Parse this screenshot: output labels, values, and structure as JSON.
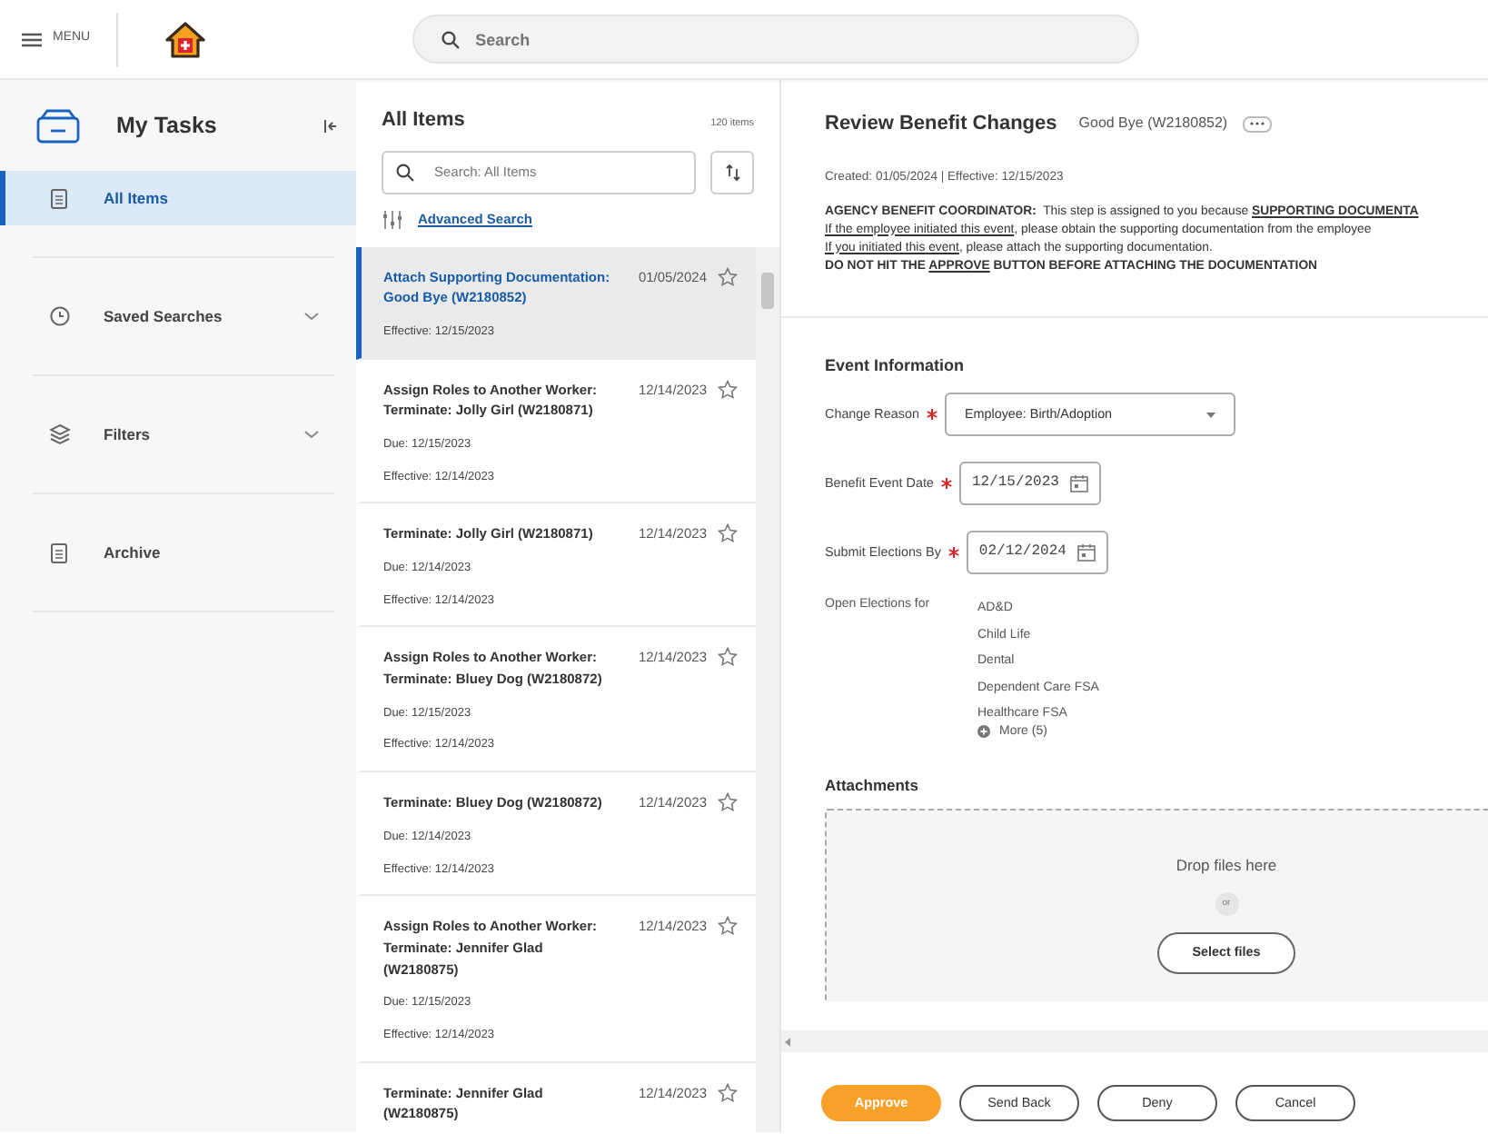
{
  "topbar": {
    "menu_label": "MENU",
    "search_placeholder": "Search"
  },
  "sidebar": {
    "title": "My Tasks",
    "items": [
      {
        "label": "All Items",
        "selected": true,
        "expandable": false
      },
      {
        "label": "Saved Searches",
        "selected": false,
        "expandable": true
      },
      {
        "label": "Filters",
        "selected": false,
        "expandable": true
      },
      {
        "label": "Archive",
        "selected": false,
        "expandable": false
      }
    ]
  },
  "list": {
    "title": "All Items",
    "count": "120 items",
    "search_placeholder": "Search: All Items",
    "advanced_search": "Advanced Search",
    "items": [
      {
        "title": "Attach Supporting Documentation: Good Bye (W2180852)",
        "date": "01/05/2024",
        "details": [
          "Effective: 12/15/2023"
        ],
        "selected": true
      },
      {
        "title": "Assign Roles to Another Worker: Terminate: Jolly Girl (W2180871)",
        "date": "12/14/2023",
        "details": [
          "Due: 12/15/2023",
          "Effective: 12/14/2023"
        ],
        "selected": false
      },
      {
        "title": "Terminate: Jolly Girl (W2180871)",
        "date": "12/14/2023",
        "details": [
          "Due: 12/14/2023",
          "Effective: 12/14/2023"
        ],
        "selected": false
      },
      {
        "title": "Assign Roles to Another Worker: Terminate: Bluey Dog (W2180872)",
        "date": "12/14/2023",
        "details": [
          "Due: 12/15/2023",
          "Effective: 12/14/2023"
        ],
        "selected": false
      },
      {
        "title": "Terminate: Bluey Dog (W2180872)",
        "date": "12/14/2023",
        "details": [
          "Due: 12/14/2023",
          "Effective: 12/14/2023"
        ],
        "selected": false
      },
      {
        "title": "Assign Roles to Another Worker: Terminate: Jennifer Glad (W2180875)",
        "date": "12/14/2023",
        "details": [
          "Due: 12/15/2023",
          "Effective: 12/14/2023"
        ],
        "selected": false
      },
      {
        "title": "Terminate: Jennifer Glad (W2180875)",
        "date": "12/14/2023",
        "selected": false
      }
    ]
  },
  "detail": {
    "title": "Review Benefit Changes",
    "subject": "Good Bye (W2180852)",
    "meta": "Created: 01/05/2024 | Effective: 12/15/2023",
    "instructions": [
      [
        {
          "text": "AGENCY BENEFIT COORDINATOR:",
          "bold": true,
          "underline": false
        },
        {
          "text": "  This step is assigned to you because ",
          "bold": false,
          "underline": false
        },
        {
          "text": "SUPPORTING DOCUMENTA",
          "bold": true,
          "underline": true
        }
      ],
      [
        {
          "text": "If the employee initiated this event",
          "bold": false,
          "underline": true
        },
        {
          "text": ", please obtain the supporting documentation from the employee",
          "bold": false,
          "underline": false
        }
      ],
      [
        {
          "text": "If you initiated this event",
          "bold": false,
          "underline": true
        },
        {
          "text": ", please attach the supporting documentation.",
          "bold": false,
          "underline": false
        }
      ],
      [
        {
          "text": "DO NOT HIT THE ",
          "bold": true,
          "underline": false
        },
        {
          "text": "APPROVE",
          "bold": true,
          "underline": true
        },
        {
          "text": " BUTTON BEFORE ATTACHING THE DOCUMENTATION",
          "bold": true,
          "underline": false
        }
      ]
    ],
    "section_title": "Event Information",
    "fields": [
      {
        "kind": "select",
        "label": "Change Reason",
        "required": true,
        "value": "Employee: Birth/Adoption"
      },
      {
        "kind": "date",
        "label": "Benefit Event Date",
        "required": true,
        "value": "12/15/2023"
      },
      {
        "kind": "date",
        "label": "Submit Elections By",
        "required": true,
        "value": "02/12/2024"
      }
    ],
    "open_elections": {
      "label": "Open Elections for",
      "items": [
        "AD&D",
        "Child Life",
        "Dental",
        "Dependent Care FSA",
        "Healthcare FSA"
      ],
      "more": "More (5)"
    },
    "attachments": {
      "title": "Attachments",
      "drop_text": "Drop files here",
      "or_text": "or",
      "button": "Select files"
    }
  },
  "actions": [
    {
      "label": "Approve",
      "primary": true
    },
    {
      "label": "Send Back",
      "primary": false
    },
    {
      "label": "Deny",
      "primary": false
    },
    {
      "label": "Cancel",
      "primary": false
    }
  ]
}
